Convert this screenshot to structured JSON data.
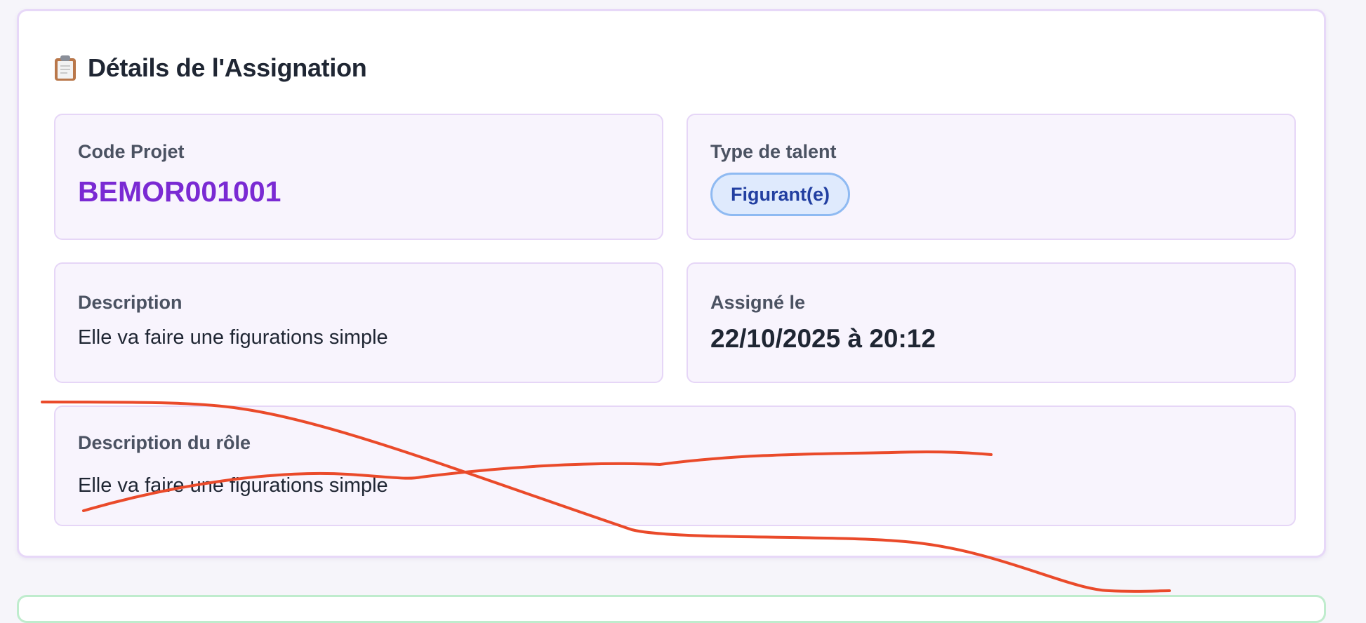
{
  "section": {
    "icon": "clipboard-icon",
    "title": "Détails de l'Assignation"
  },
  "fields": {
    "project_code": {
      "label": "Code Projet",
      "value": "BEMOR001001"
    },
    "talent_type": {
      "label": "Type de talent",
      "value": "Figurant(e)"
    },
    "description": {
      "label": "Description",
      "value": "Elle va faire une figurations simple"
    },
    "assigned_at": {
      "label": "Assigné le",
      "value": "22/10/2025 à 20:12"
    },
    "role_description": {
      "label": "Description du rôle",
      "value": "Elle va faire une figurations simple"
    }
  },
  "colors": {
    "accent_purple": "#7a2ad3",
    "badge_blue": "#223fa1",
    "annotation_red": "#ea4a2a"
  }
}
